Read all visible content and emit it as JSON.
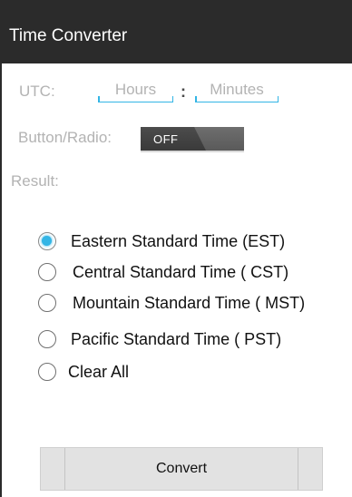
{
  "app": {
    "title": "Time Converter"
  },
  "form": {
    "utc_label": "UTC:",
    "hours": {
      "placeholder": "Hours",
      "value": ""
    },
    "separator": ":",
    "minutes": {
      "placeholder": "Minutes",
      "value": ""
    },
    "toggle_label": "Button/Radio:",
    "toggle": {
      "state_text": "OFF",
      "checked": false
    },
    "result_label": "Result:"
  },
  "radios": [
    {
      "label": "Eastern Standard Time (EST)",
      "checked": true
    },
    {
      "label": "Central Standard Time ( CST)",
      "checked": false
    },
    {
      "label": "Mountain Standard Time ( MST)",
      "checked": false
    },
    {
      "label": "Pacific Standard Time ( PST)",
      "checked": false
    },
    {
      "label": "Clear All",
      "checked": false
    }
  ],
  "convert_button": {
    "label": "Convert"
  },
  "colors": {
    "title_bar": "#2b2b2b",
    "accent": "#33b5e5",
    "label_gray": "#b3b3b3",
    "button_bg": "#e2e2e2"
  }
}
